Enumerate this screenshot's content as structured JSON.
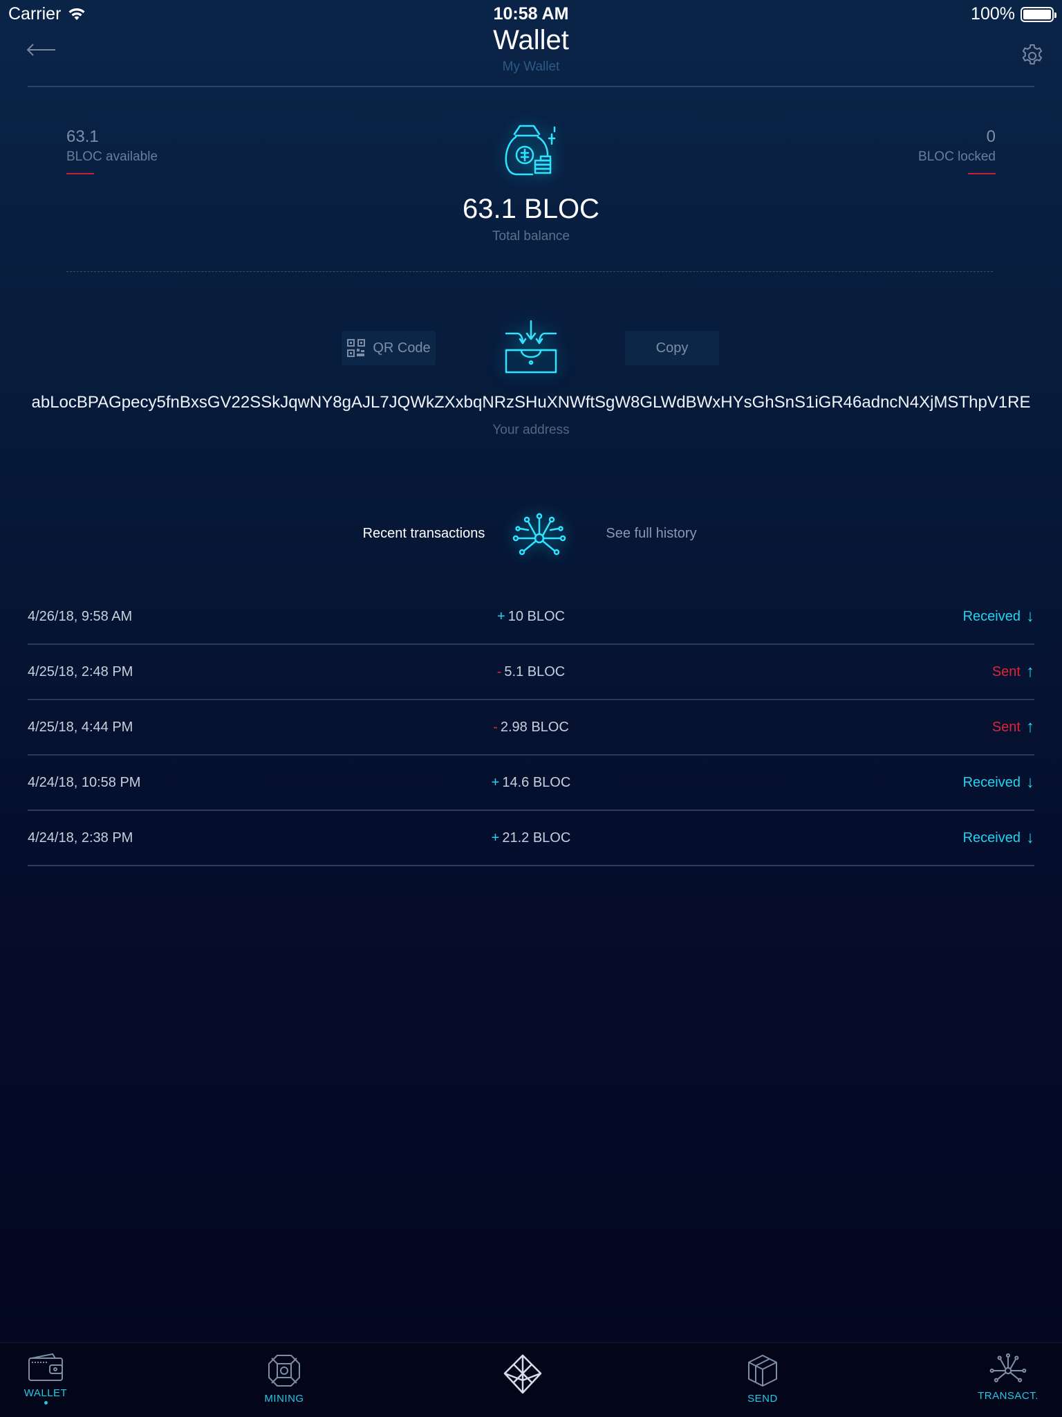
{
  "status_bar": {
    "carrier": "Carrier",
    "time": "10:58 AM",
    "battery": "100%"
  },
  "header": {
    "title": "Wallet",
    "subtitle": "My Wallet",
    "back_icon": "back-arrow-icon",
    "settings_icon": "gear-icon"
  },
  "balance": {
    "available_value": "63.1",
    "available_label": "BLOC available",
    "locked_value": "0",
    "locked_label": "BLOC locked",
    "total_value": "63.1 BLOC",
    "total_label": "Total balance"
  },
  "address_section": {
    "qr_button_label": "QR Code",
    "copy_button_label": "Copy",
    "address": "abLocBPAGpecy5fnBxsGV22SSkJqwNY8gAJL7JQWkZXxbqNRzSHuXNWftSgW8GLWdBWxHYsGhSnS1iGR46adncN4XjMSThpV1RE",
    "address_label": "Your address"
  },
  "transactions": {
    "title": "Recent transactions",
    "full_history_label": "See full history",
    "rows": [
      {
        "date": "4/26/18, 9:58 AM",
        "sign": "+",
        "amount": "10 BLOC",
        "status": "Received",
        "direction": "received"
      },
      {
        "date": "4/25/18, 2:48 PM",
        "sign": "-",
        "amount": "5.1 BLOC",
        "status": "Sent",
        "direction": "sent"
      },
      {
        "date": "4/25/18, 4:44 PM",
        "sign": "-",
        "amount": "2.98 BLOC",
        "status": "Sent",
        "direction": "sent"
      },
      {
        "date": "4/24/18, 10:58 PM",
        "sign": "+",
        "amount": "14.6 BLOC",
        "status": "Received",
        "direction": "received"
      },
      {
        "date": "4/24/18, 2:38 PM",
        "sign": "+",
        "amount": "21.2 BLOC",
        "status": "Received",
        "direction": "received"
      }
    ]
  },
  "tabbar": {
    "tabs": [
      {
        "label": "WALLET",
        "icon": "wallet-icon",
        "active": true
      },
      {
        "label": "MINING",
        "icon": "mining-icon",
        "active": false
      },
      {
        "label": "",
        "icon": "bloc-logo-icon",
        "active": false
      },
      {
        "label": "SEND",
        "icon": "send-cube-icon",
        "active": false
      },
      {
        "label": "TRANSACT.",
        "icon": "transactions-network-icon",
        "active": false
      }
    ]
  },
  "colors": {
    "accent": "#23d4f0",
    "sent": "#e0243a",
    "background_top": "#0a2448",
    "background_bottom": "#03061f"
  }
}
